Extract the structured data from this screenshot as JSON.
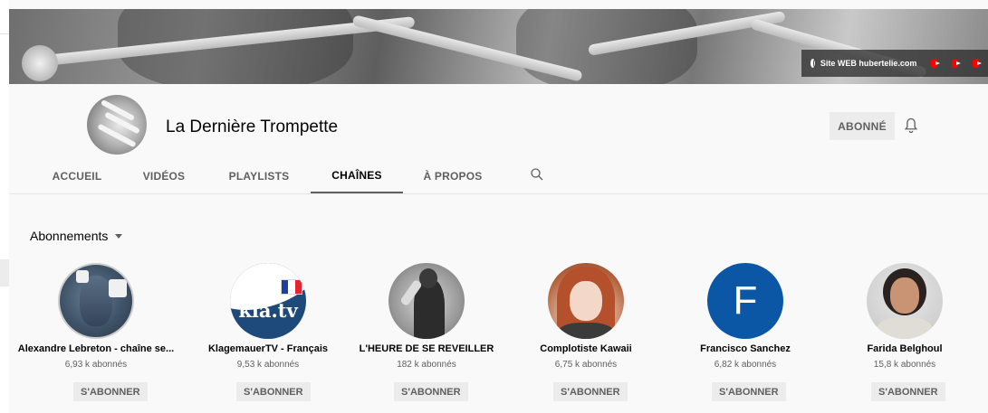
{
  "banner": {
    "site_link_label": "Site WEB hubertelie.com",
    "site_link_icon": "globe-icon",
    "social_icons": [
      "youtube-icon",
      "youtube-icon",
      "youtube-icon"
    ]
  },
  "channel": {
    "name": "La Dernière Trompette",
    "subscribe_state_label": "ABONNÉ",
    "notification_icon": "bell-icon"
  },
  "tabs": [
    {
      "label": "ACCUEIL",
      "active": false
    },
    {
      "label": "VIDÉOS",
      "active": false
    },
    {
      "label": "PLAYLISTS",
      "active": false
    },
    {
      "label": "CHAÎNES",
      "active": true
    },
    {
      "label": "À PROPOS",
      "active": false
    }
  ],
  "section": {
    "title": "Abonnements"
  },
  "channels": [
    {
      "name": "Alexandre Lebreton - chaîne se...",
      "subscribers": "6,93 k abonnés",
      "button": "S'ABONNER"
    },
    {
      "name": "KlagemauerTV - Français",
      "subscribers": "9,53 k abonnés",
      "button": "S'ABONNER",
      "logo_text": "kla.tv"
    },
    {
      "name": "L'HEURE DE SE REVEILLER",
      "subscribers": "182 k abonnés",
      "button": "S'ABONNER"
    },
    {
      "name": "Complotiste Kawaii",
      "subscribers": "6,75 k abonnés",
      "button": "S'ABONNER"
    },
    {
      "name": "Francisco Sanchez",
      "subscribers": "6,82 k abonnés",
      "button": "S'ABONNER",
      "avatar_letter": "F"
    },
    {
      "name": "Farida Belghoul",
      "subscribers": "15,8 k abonnés",
      "button": "S'ABONNER"
    }
  ],
  "colors": {
    "background": "#f9f9f9",
    "button_bg": "#ececec",
    "secondary_text": "#606060",
    "primary_text": "#030303",
    "youtube_red": "#ff0000",
    "francisco_blue": "#0b57a6"
  }
}
